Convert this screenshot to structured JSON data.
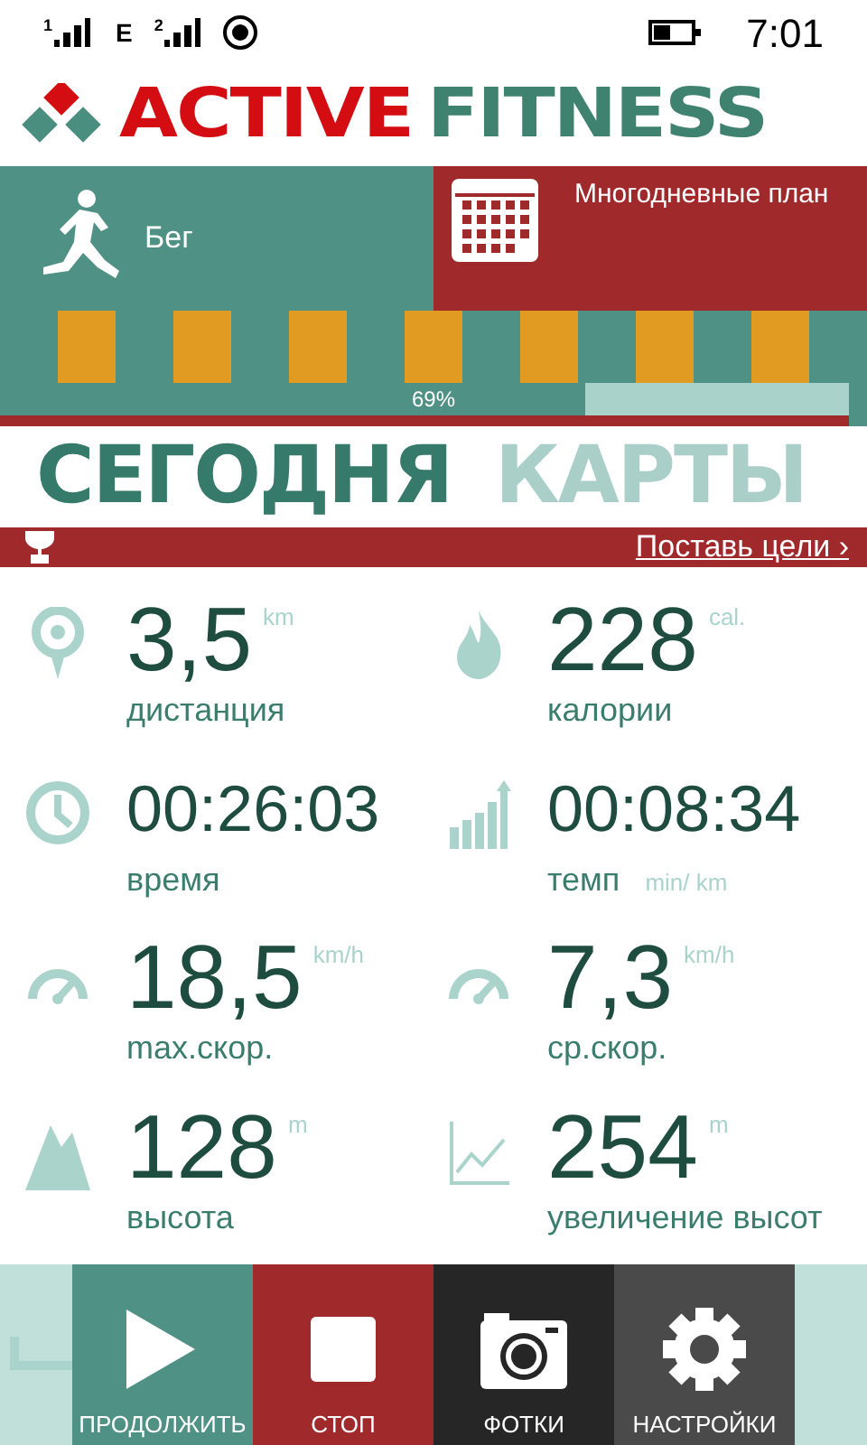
{
  "status_bar": {
    "sim1": "1",
    "network": "E",
    "sim2": "2",
    "time": "7:01"
  },
  "logo": {
    "word1": "ACTIVE",
    "word2": "FITNESS"
  },
  "tiles": [
    {
      "kind": "run",
      "label": "Бег"
    },
    {
      "kind": "plan",
      "label": "Многодневные план"
    }
  ],
  "progress": {
    "level": 0.69,
    "reading": "69%"
  },
  "tabs": [
    {
      "label": "СЕГОДНЯ",
      "selected": true
    },
    {
      "label": "КАРТЫ",
      "selected": false
    }
  ],
  "goals_link": "Поставь цели ›",
  "stats": [
    {
      "kind": "measure",
      "value": "3,5",
      "unit": "km",
      "label": "дистанция"
    },
    {
      "kind": "measure",
      "value": "228",
      "unit": "cal.",
      "label": "калории"
    },
    {
      "kind": "time",
      "value": "00:26:03",
      "label": "время"
    },
    {
      "kind": "time-paced",
      "value": "00:08:34",
      "unit": "min/ km",
      "label": "темп"
    },
    {
      "kind": "measure",
      "value": "18,5",
      "unit": "km/h",
      "label": "max.скор."
    },
    {
      "kind": "measure",
      "value": "7,3",
      "unit": "km/h",
      "label": "ср.скор."
    },
    {
      "kind": "measure",
      "value": "128",
      "unit": "m",
      "label": "высота"
    },
    {
      "kind": "measure",
      "value": "254",
      "unit": "m",
      "label": "увеличение высот"
    }
  ],
  "toolbar": [
    {
      "kind": "play",
      "label": "ПРОДОЛЖИТЬ"
    },
    {
      "kind": "stop",
      "label": "СТОП"
    },
    {
      "kind": "camera",
      "label": "ФОТКИ"
    },
    {
      "kind": "settings",
      "label": "НАСТРОЙКИ"
    }
  ]
}
